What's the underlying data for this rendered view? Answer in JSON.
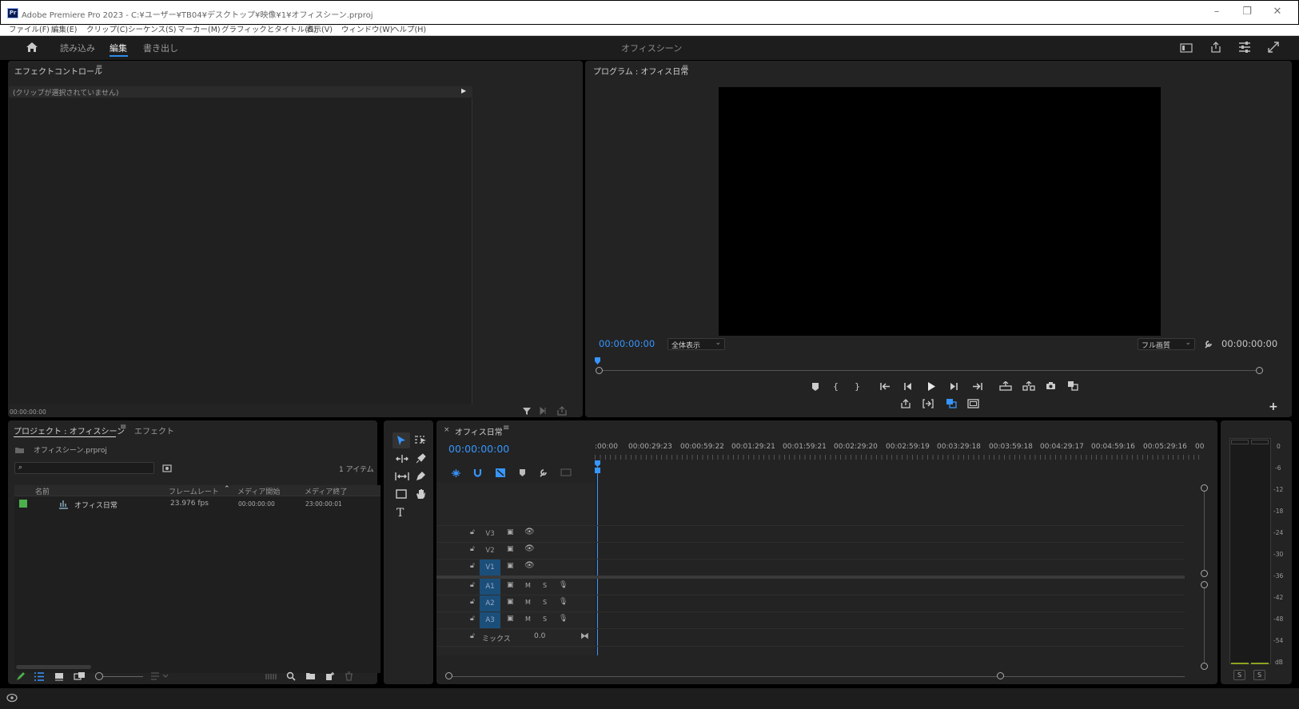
{
  "app": {
    "title": "Adobe Premiere Pro 2023 - C:¥ユーザー¥TB04¥デスクトップ¥映像¥1¥オフィスシーン.prproj",
    "logo": "Pr"
  },
  "menu": [
    "ファイル(F)",
    "編集(E)",
    "クリップ(C)",
    "シーケンス(S)",
    "マーカー(M)",
    "グラフィックとタイトル(G)",
    "表示(V)",
    "ウィンドウ(W)",
    "ヘルプ(H)"
  ],
  "workspace": {
    "tabs": [
      "読み込み",
      "編集",
      "書き出し"
    ],
    "active_tab": "編集",
    "project_name": "オフィスシーン"
  },
  "effect_controls": {
    "title": "エフェクトコントロール",
    "no_clip": "(クリップが選択されていません)",
    "timecode": "00:00:00:00"
  },
  "program_monitor": {
    "title": "プログラム : オフィス日常",
    "timecode_left": "00:00:00:00",
    "zoom": "全体表示",
    "quality": "フル画質",
    "timecode_right": "00:00:00:00"
  },
  "project": {
    "title": "プロジェクト : オフィスシーン",
    "tab2": "エフェクト",
    "file": "オフィスシーン.prproj",
    "count": "1 アイテム",
    "columns": [
      "名前",
      "フレームレート",
      "メディア開始",
      "メディア終了"
    ],
    "rows": [
      {
        "name": "オフィス日常",
        "fps": "23.976 fps",
        "start": "00:00:00:00",
        "end": "23:00:00:01",
        "color": "#4cb04c"
      }
    ]
  },
  "timeline": {
    "title": "オフィス日常",
    "timecode": "00:00:00:00",
    "ruler": [
      ":00:00",
      "00:00:29:23",
      "00:00:59:22",
      "00:01:29:21",
      "00:01:59:21",
      "00:02:29:20",
      "00:02:59:19",
      "00:03:29:18",
      "00:03:59:18",
      "00:04:29:17",
      "00:04:59:16",
      "00:05:29:16",
      "00"
    ],
    "video_tracks": [
      "V3",
      "V2",
      "V1"
    ],
    "audio_tracks": [
      "A1",
      "A2",
      "A3"
    ],
    "mix_label": "ミックス",
    "mix_value": "0.0",
    "mute": "M",
    "solo": "S"
  },
  "audio_meter": {
    "scale": [
      "0",
      "-6",
      "-12",
      "-18",
      "-24",
      "-30",
      "-36",
      "-42",
      "-48",
      "-54",
      "dB"
    ],
    "solo_left": "S",
    "solo_right": "S"
  }
}
